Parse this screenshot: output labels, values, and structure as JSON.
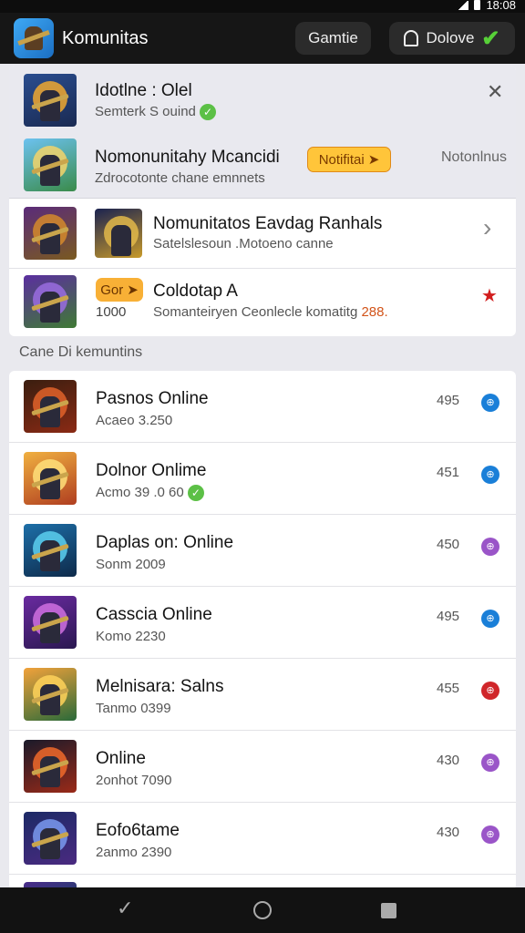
{
  "status_bar": {
    "time": "18:08"
  },
  "header": {
    "title": "Komunitas",
    "gamie_button": "Gamtie",
    "dolove_button": "Dolove"
  },
  "top_card": {
    "notification_1": {
      "title": "Idotlne : Olel",
      "subtitle": "Semterk S ouind"
    },
    "notification_2": {
      "title": "Nomonunitahy Mcancidi",
      "subtitle": "Zdrocotonte chane emnnets",
      "pill": "Notifitai",
      "side_text": "Notonlnus"
    },
    "row_3": {
      "title": "Nomunitatos Eavdag Ranhals",
      "subtitle": "Satelslesoun .Motoeno canne"
    },
    "row_4": {
      "pill": "Gor",
      "pill_sub": "1000",
      "title": "Coldotap A",
      "subtitle_text": "Somanteiryen Ceonlecle komatitg",
      "subtitle_highlight": "288."
    }
  },
  "section_label": "Cane Di kemuntins",
  "list": {
    "items": [
      {
        "title": "Pasnos Online",
        "subtitle": "Acaeo 3.250",
        "value": "495"
      },
      {
        "title": "Dolnor Onlime",
        "subtitle": "Acmo 39 .0 60",
        "value": "451"
      },
      {
        "title": "Daplas on: Online",
        "subtitle": "Sonm 2009",
        "value": "450"
      },
      {
        "title": "Casscia Online",
        "subtitle": "Komo 2230",
        "value": "495"
      },
      {
        "title": "Melnisara: Salns",
        "subtitle": "Tanmo 0399",
        "value": "455"
      },
      {
        "title": "Online",
        "subtitle": "2onhot 7090",
        "value": "430"
      },
      {
        "title": "Eofo6tame",
        "subtitle": "2anmo 2390",
        "value": "430"
      }
    ]
  },
  "colors": {
    "accent_blue": "#1a7fd8",
    "accent_purple": "#9a55c8",
    "accent_red": "#d0262a",
    "pill_yellow": "#ffc53a",
    "header_bg": "#161616"
  }
}
